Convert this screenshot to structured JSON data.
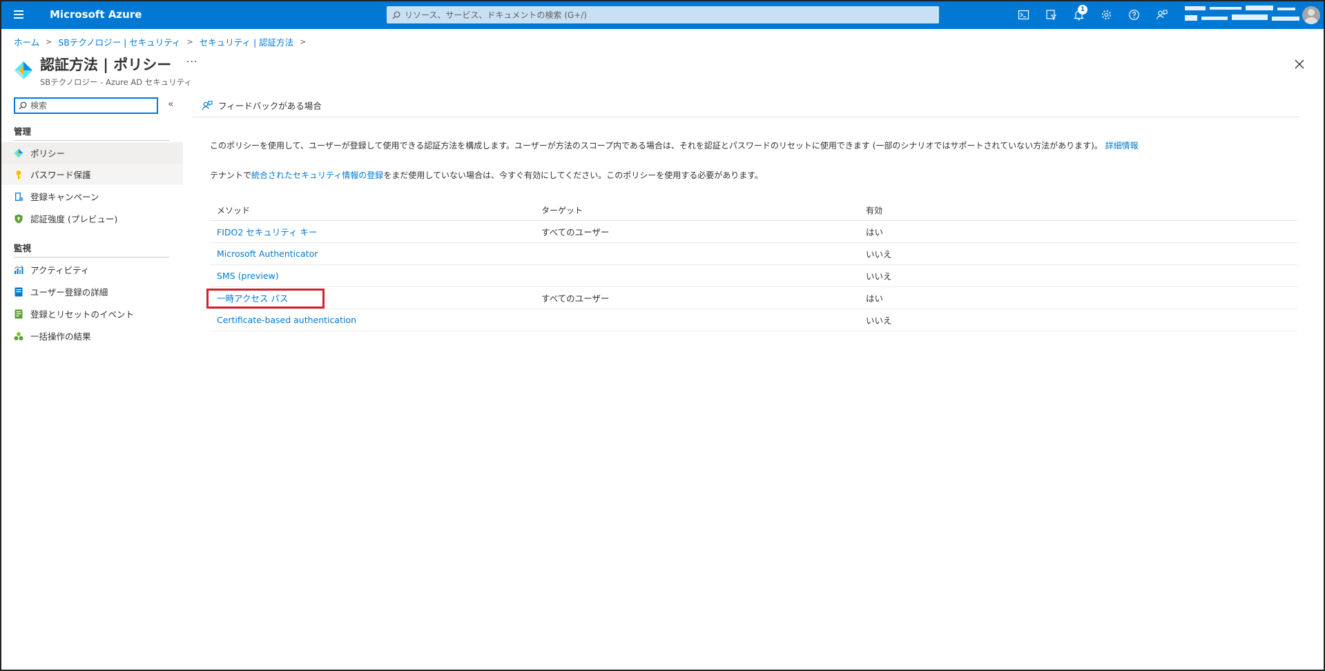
{
  "topbar": {
    "brand": "Microsoft Azure",
    "search_placeholder": "リソース、サービス、ドキュメントの検索 (G+/)",
    "notification_count": "1",
    "colors": {
      "accent": "#0078d4",
      "link": "#0078d4",
      "highlight": "#d1202f"
    }
  },
  "breadcrumb": [
    "ホーム",
    "SBテクノロジー | セキュリティ",
    "セキュリティ | 認証方法"
  ],
  "header": {
    "title": "認証方法 | ポリシー",
    "subtitle": "SBテクノロジー - Azure AD セキュリティ",
    "more": "···"
  },
  "sidebar": {
    "search_placeholder": "検索",
    "collapse": "«",
    "sections": [
      {
        "label": "管理",
        "items": [
          {
            "label": "ポリシー",
            "icon": "policy-diamond-icon"
          },
          {
            "label": "パスワード保護",
            "icon": "key-icon"
          },
          {
            "label": "登録キャンペーン",
            "icon": "campaign-icon"
          },
          {
            "label": "認証強度 (プレビュー)",
            "icon": "shield-icon"
          }
        ]
      },
      {
        "label": "監視",
        "items": [
          {
            "label": "アクティビティ",
            "icon": "activity-chart-icon"
          },
          {
            "label": "ユーザー登録の詳細",
            "icon": "user-details-icon"
          },
          {
            "label": "登録とリセットのイベント",
            "icon": "events-icon"
          },
          {
            "label": "一括操作の結果",
            "icon": "bulk-results-icon"
          }
        ]
      }
    ]
  },
  "main": {
    "feedback": "フィードバックがある場合",
    "desc1": "このポリシーを使用して、ユーザーが登録して使用できる認証方法を構成します。ユーザーが方法のスコープ内である場合は、それを認証とパスワードのリセットに使用できます (一部のシナリオではサポートされていない方法があります)。",
    "desc1_link": "詳細情報",
    "desc2_pre": "テナントで",
    "desc2_link": "統合されたセキュリティ情報の登録",
    "desc2_post": "をまだ使用していない場合は、今すぐ有効にしてください。このポリシーを使用する必要があります。",
    "table": {
      "headers": [
        "メソッド",
        "ターゲット",
        "有効"
      ],
      "rows": [
        {
          "method": "FIDO2 セキュリティ キー",
          "target": "すべてのユーザー",
          "enabled": "はい"
        },
        {
          "method": "Microsoft Authenticator",
          "target": "",
          "enabled": "いいえ"
        },
        {
          "method": "SMS (preview)",
          "target": "",
          "enabled": "いいえ"
        },
        {
          "method": "一時アクセス パス",
          "target": "すべてのユーザー",
          "enabled": "はい"
        },
        {
          "method": "Certificate-based authentication",
          "target": "",
          "enabled": "いいえ"
        }
      ]
    }
  }
}
